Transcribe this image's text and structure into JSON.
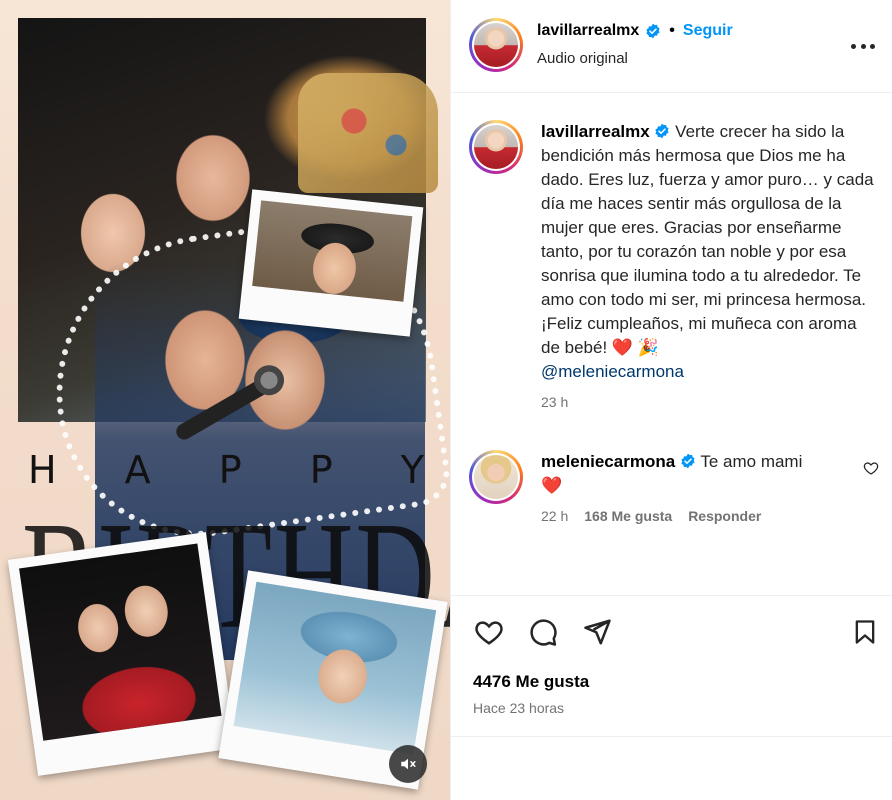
{
  "media": {
    "happy_letters": [
      "H",
      "A",
      "P",
      "P",
      "Y"
    ],
    "birthday_text": "BIRTHDAY",
    "mute_icon": "speaker-muted-icon"
  },
  "post_header": {
    "username": "lavillarrealmx",
    "separator": "•",
    "follow_label": "Seguir",
    "audio_label": "Audio original",
    "more_icon": "more-options-icon"
  },
  "caption": {
    "username": "lavillarrealmx",
    "text": "Verte crecer ha sido la bendición más hermosa que Dios me ha dado. Eres luz, fuerza y amor puro… y cada día me haces sentir más orgullosa de la mujer que eres. Gracias por enseñarme tanto, por tu corazón tan noble y por esa sonrisa que ilumina todo a tu alrededor. Te amo con todo mi ser, mi princesa hermosa. ¡Feliz cumpleaños, mi muñeca con aroma de bebé! ",
    "emoji": "❤️ 🎉",
    "mention": "@meleniecarmona",
    "time": "23 h"
  },
  "reply": {
    "username": "meleniecarmona",
    "text": "Te amo mami",
    "emoji": "❤️",
    "time": "22 h",
    "likes": "168 Me gusta",
    "reply_label": "Responder"
  },
  "actions": {
    "likes": "4476 Me gusta",
    "time": "Hace 23 horas"
  },
  "colors": {
    "accent": "#0095f6",
    "mention": "#00376b",
    "muted": "#737373",
    "heart": "#e0131f"
  }
}
